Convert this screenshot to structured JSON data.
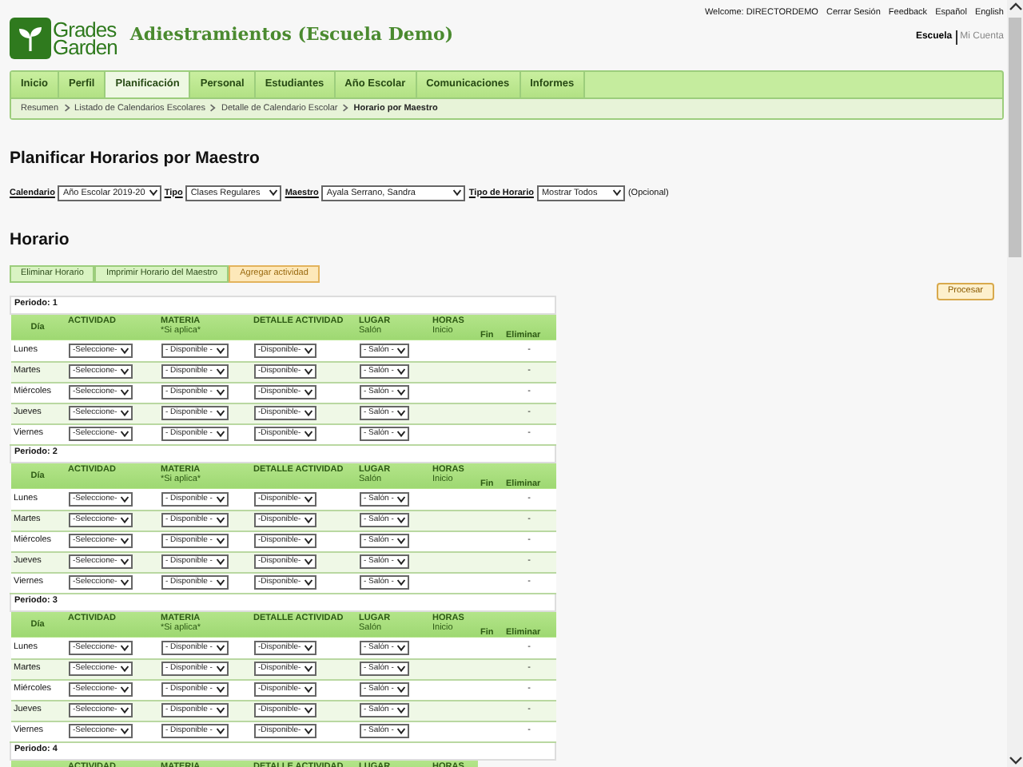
{
  "header": {
    "logo_lines": [
      "Grades",
      "Garden"
    ],
    "school_title": "Adiestramientos (Escuela Demo)",
    "user_links": [
      "Welcome: DIRECTORDEMO",
      "Cerrar Sesión",
      "Feedback",
      "Español",
      "English"
    ],
    "account_links": [
      {
        "label": "Escuela",
        "selected": true
      },
      {
        "label": "Mi Cuenta",
        "selected": false
      }
    ]
  },
  "nav_tabs": [
    {
      "label": "Inicio",
      "selected": false
    },
    {
      "label": "Perfil",
      "selected": false
    },
    {
      "label": "Planificación",
      "selected": true
    },
    {
      "label": "Personal",
      "selected": false
    },
    {
      "label": "Estudiantes",
      "selected": false
    },
    {
      "label": "Año Escolar",
      "selected": false
    },
    {
      "label": "Comunicaciones",
      "selected": false
    },
    {
      "label": "Informes",
      "selected": false
    }
  ],
  "breadcrumb": [
    "Resumen",
    "Listado de Calendarios Escolares",
    "Detalle de Calendario Escolar",
    "Horario por Maestro"
  ],
  "page_title": "Planificar Horarios por Maestro",
  "filters": [
    {
      "label": "Calendario",
      "value": "Año Escolar 2019-20"
    },
    {
      "label": "Tipo",
      "value": "Clases Regulares"
    },
    {
      "label": "Maestro",
      "value": "Ayala Serrano, Sandra"
    },
    {
      "label": "Tipo de Horario",
      "value": "Mostrar Todos"
    }
  ],
  "filters_note": "(Opcional)",
  "section_title": "Horario",
  "action_buttons": [
    {
      "label": "Eliminar Horario",
      "kind": "normal"
    },
    {
      "label": "Imprimir Horario del Maestro",
      "kind": "normal"
    },
    {
      "label": "Agregar actividad",
      "kind": "highlight"
    }
  ],
  "process_button": "Procesar",
  "periods": [
    {
      "title": "Periodo: 1",
      "columns": [
        {
          "label": "Día"
        },
        {
          "label": "ACTIVIDAD"
        },
        {
          "label": "MATERIA",
          "sublabel": "*Si aplica*"
        },
        {
          "label": "DETALLE ACTIVIDAD"
        },
        {
          "label": "LUGAR",
          "sublabel": "Salón"
        },
        {
          "label": "HORAS",
          "sublabel": "Inicio"
        },
        {
          "label": "Fin"
        },
        {
          "label": "Eliminar"
        }
      ],
      "rows": [
        {
          "day": "Lunes",
          "actividad": "-Seleccione-",
          "materia": "- Disponible -",
          "detalle": "-Disponible-",
          "lugar": "- Salón -",
          "eliminar": "-"
        },
        {
          "day": "Martes",
          "actividad": "-Seleccione-",
          "materia": "- Disponible -",
          "detalle": "-Disponible-",
          "lugar": "- Salón -",
          "eliminar": "-"
        },
        {
          "day": "Miércoles",
          "actividad": "-Seleccione-",
          "materia": "- Disponible -",
          "detalle": "-Disponible-",
          "lugar": "- Salón -",
          "eliminar": "-"
        },
        {
          "day": "Jueves",
          "actividad": "-Seleccione-",
          "materia": "- Disponible -",
          "detalle": "-Disponible-",
          "lugar": "- Salón -",
          "eliminar": "-"
        },
        {
          "day": "Viernes",
          "actividad": "-Seleccione-",
          "materia": "- Disponible -",
          "detalle": "-Disponible-",
          "lugar": "- Salón -",
          "eliminar": "-"
        }
      ]
    },
    {
      "title": "Periodo: 2",
      "columns": [
        {
          "label": "Día"
        },
        {
          "label": "ACTIVIDAD"
        },
        {
          "label": "MATERIA",
          "sublabel": "*Si aplica*"
        },
        {
          "label": "DETALLE ACTIVIDAD"
        },
        {
          "label": "LUGAR",
          "sublabel": "Salón"
        },
        {
          "label": "HORAS",
          "sublabel": "Inicio"
        },
        {
          "label": "Fin"
        },
        {
          "label": "Eliminar"
        }
      ],
      "rows": [
        {
          "day": "Lunes",
          "actividad": "-Seleccione-",
          "materia": "- Disponible -",
          "detalle": "-Disponible-",
          "lugar": "- Salón -",
          "eliminar": "-"
        },
        {
          "day": "Martes",
          "actividad": "-Seleccione-",
          "materia": "- Disponible -",
          "detalle": "-Disponible-",
          "lugar": "- Salón -",
          "eliminar": "-"
        },
        {
          "day": "Miércoles",
          "actividad": "-Seleccione-",
          "materia": "- Disponible -",
          "detalle": "-Disponible-",
          "lugar": "- Salón -",
          "eliminar": "-"
        },
        {
          "day": "Jueves",
          "actividad": "-Seleccione-",
          "materia": "- Disponible -",
          "detalle": "-Disponible-",
          "lugar": "- Salón -",
          "eliminar": "-"
        },
        {
          "day": "Viernes",
          "actividad": "-Seleccione-",
          "materia": "- Disponible -",
          "detalle": "-Disponible-",
          "lugar": "- Salón -",
          "eliminar": "-"
        }
      ]
    },
    {
      "title": "Periodo: 3",
      "columns": [
        {
          "label": "Día"
        },
        {
          "label": "ACTIVIDAD"
        },
        {
          "label": "MATERIA",
          "sublabel": "*Si aplica*"
        },
        {
          "label": "DETALLE ACTIVIDAD"
        },
        {
          "label": "LUGAR",
          "sublabel": "Salón"
        },
        {
          "label": "HORAS",
          "sublabel": "Inicio"
        },
        {
          "label": "Fin"
        },
        {
          "label": "Eliminar"
        }
      ],
      "rows": [
        {
          "day": "Lunes",
          "actividad": "-Seleccione-",
          "materia": "- Disponible -",
          "detalle": "-Disponible-",
          "lugar": "- Salón -",
          "eliminar": "-"
        },
        {
          "day": "Martes",
          "actividad": "-Seleccione-",
          "materia": "- Disponible -",
          "detalle": "-Disponible-",
          "lugar": "- Salón -",
          "eliminar": "-"
        },
        {
          "day": "Miércoles",
          "actividad": "-Seleccione-",
          "materia": "- Disponible -",
          "detalle": "-Disponible-",
          "lugar": "- Salón -",
          "eliminar": "-"
        },
        {
          "day": "Jueves",
          "actividad": "-Seleccione-",
          "materia": "- Disponible -",
          "detalle": "-Disponible-",
          "lugar": "- Salón -",
          "eliminar": "-"
        },
        {
          "day": "Viernes",
          "actividad": "-Seleccione-",
          "materia": "- Disponible -",
          "detalle": "-Disponible-",
          "lugar": "- Salón -",
          "eliminar": "-"
        }
      ]
    },
    {
      "title": "Periodo: 4",
      "columns": [
        {
          "label": "ACTIVIDAD"
        },
        {
          "label": "MATERIA"
        },
        {
          "label": "DETALLE ACTIVIDAD"
        },
        {
          "label": "LUGAR"
        },
        {
          "label": "HORAS"
        }
      ]
    }
  ]
}
